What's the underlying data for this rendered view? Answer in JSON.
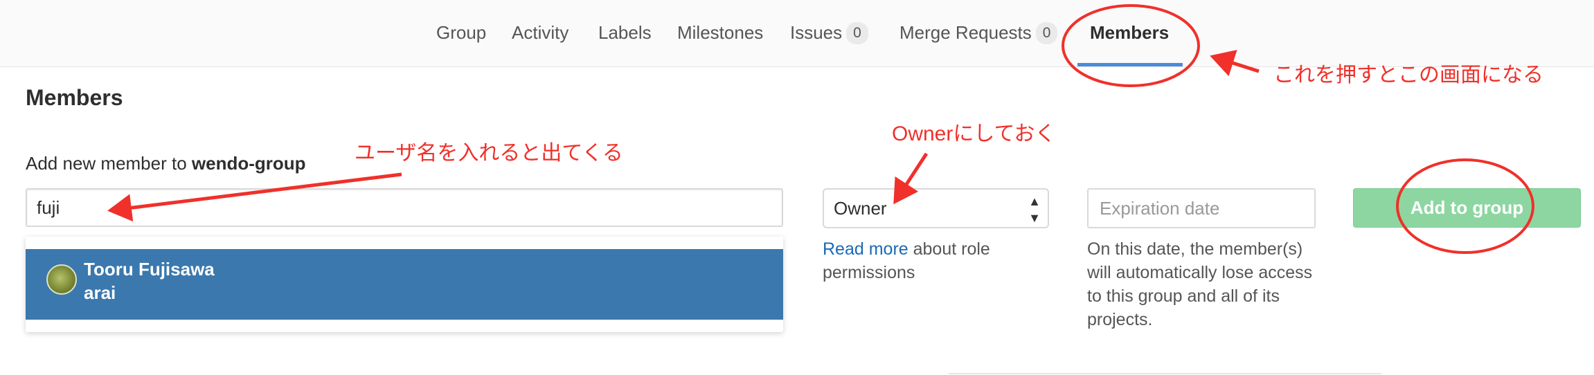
{
  "nav": {
    "items": [
      {
        "label": "Group"
      },
      {
        "label": "Activity"
      },
      {
        "label": "Labels"
      },
      {
        "label": "Milestones"
      },
      {
        "label": "Issues",
        "count": "0"
      },
      {
        "label": "Merge Requests",
        "count": "0"
      },
      {
        "label": "Members",
        "active": true
      }
    ]
  },
  "page": {
    "title": "Members",
    "add_label_prefix": "Add new member to ",
    "group_name": "wendo-group"
  },
  "form": {
    "search_value": "fuji",
    "role_value": "Owner",
    "expiration_placeholder": "Expiration date",
    "read_more_link": "Read more",
    "read_more_suffix": " about role permissions",
    "expiration_help": "On this date, the member(s) will automatically lose access to this group and all of its projects.",
    "submit_label": "Add to group"
  },
  "suggestions": [
    {
      "name": "Tooru Fujisawa",
      "username": "arai"
    }
  ],
  "annotations": {
    "members_note": "これを押すとこの画面になる",
    "owner_note": "Ownerにしておく",
    "user_note": "ユーザ名を入れると出てくる"
  },
  "colors": {
    "annotation_red": "#f0302a",
    "active_tab_underline": "#4a8bdb",
    "suggestion_bg": "#3b78ad",
    "submit_bg": "#8dd6a1",
    "link": "#1b69b6"
  }
}
